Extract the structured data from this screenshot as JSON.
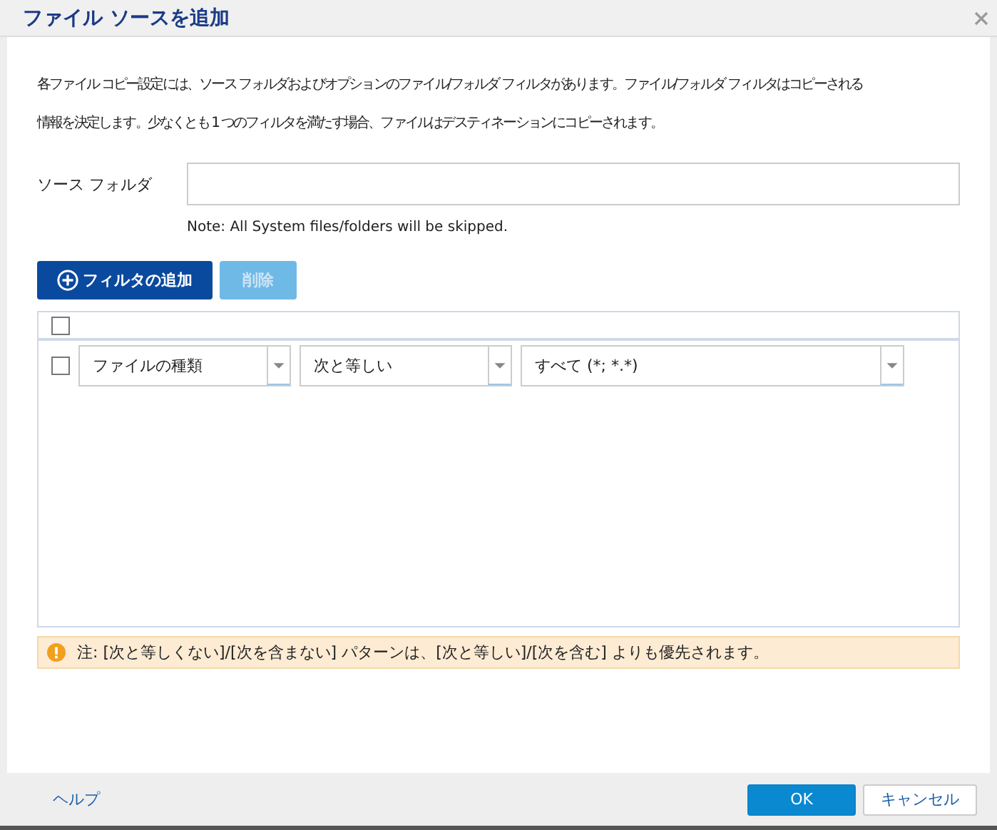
{
  "window": {
    "title": "ファイル ソースを追加"
  },
  "description": [
    "各ファイル コピー設定には、ソース フォルダおよびオプションのファイル/フォルダ フィルタがあります。ファイル/フォルダ フィルタはコピーされる",
    "情報を決定します。少なくとも 1 つのフィルタを満たす場合、ファイルはデスティネーションにコピーされます。"
  ],
  "source_folder": {
    "label": "ソース フォルダ",
    "note": "Note: All System files/folders will be skipped."
  },
  "toolbar": [
    {
      "kind": "add",
      "label": "フィルタの追加",
      "disabled": false
    },
    {
      "kind": "delete",
      "label": "削除",
      "disabled": true
    }
  ],
  "table": {
    "header_checked": false,
    "rows": [
      {
        "checked": false,
        "field": "ファイルの種類",
        "operator": "次と等しい",
        "value": "すべて (*; *.*)"
      }
    ]
  },
  "warning": "注: [次と等しくない]/[次を含まない] パターンは、[次と等しい]/[次を含む] よりも優先されます。",
  "footer": {
    "help": "ヘルプ",
    "buttons": [
      {
        "kind": "primary",
        "label": "OK"
      },
      {
        "kind": "secondary",
        "label": "キャンセル"
      }
    ]
  }
}
